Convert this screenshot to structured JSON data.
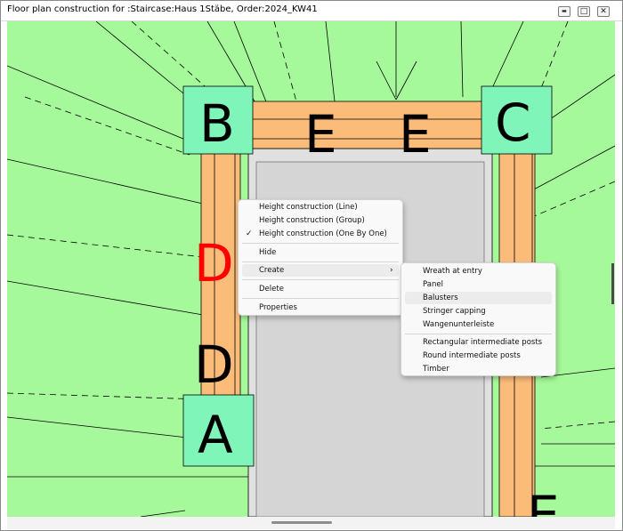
{
  "window": {
    "title": "Floor plan construction for :Staircase:Haus 1Stäbe, Order:2024_KW41",
    "controls": {
      "minimize": "▬",
      "maximize": "□",
      "close": "✕"
    }
  },
  "drawing": {
    "colors": {
      "background": "#a6f99a",
      "stringer": "#fbbc7a",
      "post": "#7ff5b9",
      "well": "#e0e0e0",
      "highlight_label": "#ff0000",
      "label": "#000000"
    },
    "labels": {
      "post_top_left": "B",
      "post_top_right": "C",
      "post_bottom_left": "A",
      "stringer_top_1": "E",
      "stringer_top_2": "E",
      "stringer_left_selected": "D",
      "stringer_left": "D",
      "stringer_right_bottom": "E"
    }
  },
  "context_menu": {
    "items": [
      {
        "label": "Height construction (Line)",
        "checked": false
      },
      {
        "label": "Height construction (Group)",
        "checked": false
      },
      {
        "label": "Height construction (One By One)",
        "checked": true
      },
      {
        "label": "Hide"
      },
      {
        "label": "Create",
        "has_submenu": true,
        "highlighted": true
      },
      {
        "label": "Delete"
      },
      {
        "label": "Properties"
      }
    ],
    "check_glyph": "✓",
    "submenu_arrow": "›"
  },
  "submenu": {
    "items": [
      {
        "label": "Wreath at entry"
      },
      {
        "label": "Panel"
      },
      {
        "label": "Balusters",
        "highlighted": true
      },
      {
        "label": "Stringer capping"
      },
      {
        "label": "Wangenunterleiste"
      },
      {
        "label": "Rectangular intermediate posts"
      },
      {
        "label": "Round intermediate posts"
      },
      {
        "label": "Timber"
      }
    ]
  }
}
